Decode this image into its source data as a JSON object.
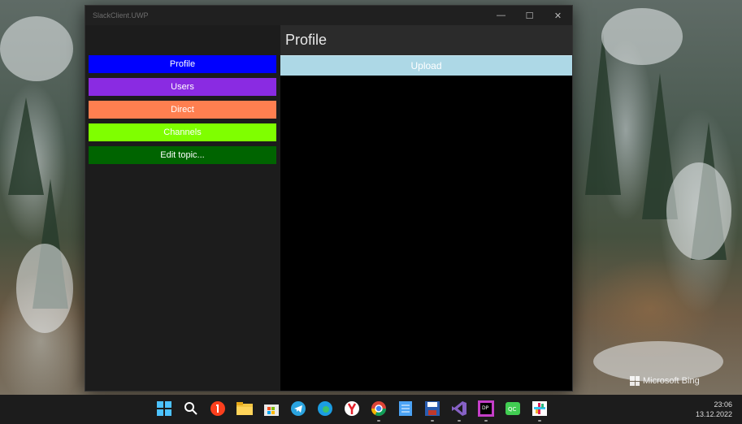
{
  "window": {
    "title": "SlackClient.UWP",
    "controls": {
      "minimize": "—",
      "maximize": "☐",
      "close": "✕"
    }
  },
  "sidebar": {
    "items": [
      {
        "label": "Profile",
        "color": "#0000ff"
      },
      {
        "label": "Users",
        "color": "#8a2be2"
      },
      {
        "label": "Direct",
        "color": "#ff7f50"
      },
      {
        "label": "Channels",
        "color": "#7fff00"
      },
      {
        "label": "Edit topic...",
        "color": "#006400"
      }
    ]
  },
  "main": {
    "title": "Profile",
    "upload_label": "Upload",
    "upload_color": "#add8e6"
  },
  "desktop": {
    "watermark": "Microsoft Bing"
  },
  "taskbar": {
    "icons": [
      "windows-start-icon",
      "search-icon",
      "yandex-browser-icon",
      "file-explorer-icon",
      "microsoft-store-icon",
      "telegram-icon",
      "edge-icon",
      "yandex-icon",
      "chrome-icon",
      "notepad-icon",
      "save-disk-icon",
      "visual-studio-icon",
      "jetbrains-dotpeek-icon",
      "qt-creator-icon",
      "slack-icon"
    ],
    "time": "23:06",
    "date": "13.12.2022"
  }
}
